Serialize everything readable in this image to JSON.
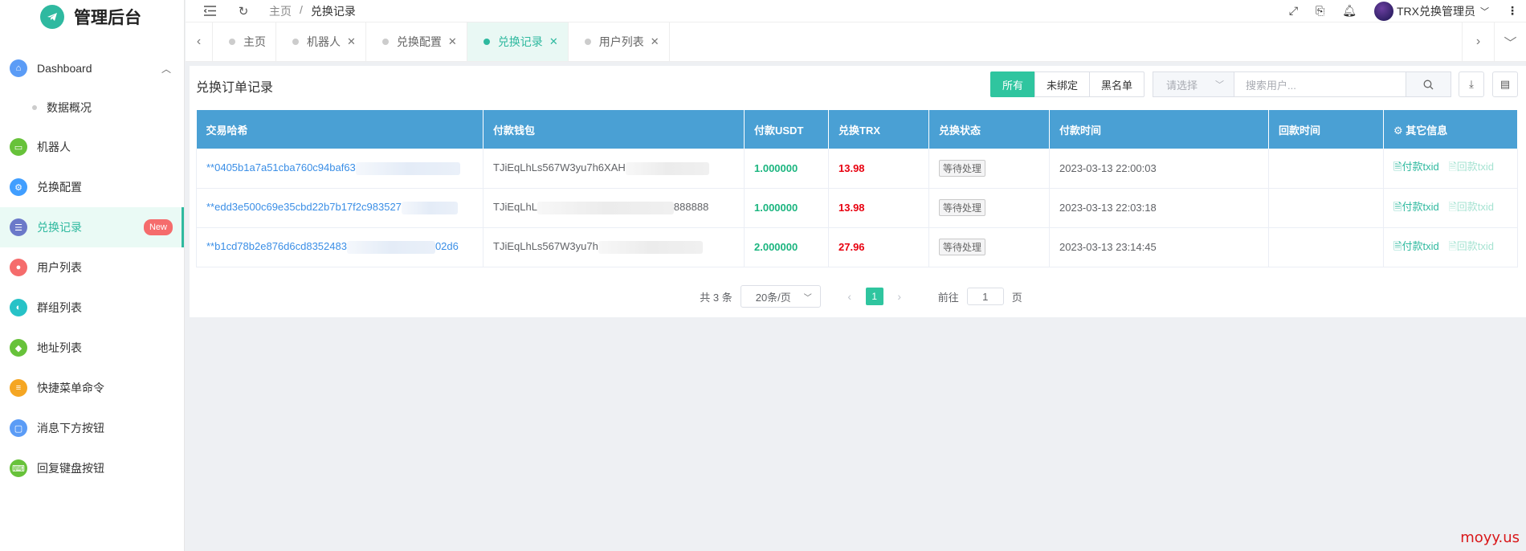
{
  "brand": {
    "title": "管理后台"
  },
  "sidebar": {
    "items": [
      {
        "label": "Dashboard",
        "icon": "home-icon",
        "color": "#5b9cf6",
        "expanded": true
      },
      {
        "label": "数据概况",
        "sub": true
      },
      {
        "label": "机器人",
        "icon": "robot-icon",
        "color": "#67c23a"
      },
      {
        "label": "兑换配置",
        "icon": "config-icon",
        "color": "#409eff"
      },
      {
        "label": "兑换记录",
        "icon": "record-icon",
        "color": "#6b79c9",
        "active": true,
        "badge": "New"
      },
      {
        "label": "用户列表",
        "icon": "user-icon",
        "color": "#f56c6c"
      },
      {
        "label": "群组列表",
        "icon": "group-icon",
        "color": "#27c2c7"
      },
      {
        "label": "地址列表",
        "icon": "box-icon",
        "color": "#67c23a"
      },
      {
        "label": "快捷菜单命令",
        "icon": "menu-cmd-icon",
        "color": "#f5a623"
      },
      {
        "label": "消息下方按钮",
        "icon": "button-icon",
        "color": "#5b9cf6"
      },
      {
        "label": "回复键盘按钮",
        "icon": "keyboard-icon",
        "color": "#67c23a"
      }
    ]
  },
  "header": {
    "breadcrumb": [
      "主页",
      "/",
      "兑换记录"
    ],
    "user_name": "TRX兑换管理员"
  },
  "tabs": [
    {
      "label": "主页",
      "closable": false
    },
    {
      "label": "机器人",
      "closable": true
    },
    {
      "label": "兑换配置",
      "closable": true
    },
    {
      "label": "兑换记录",
      "closable": true,
      "active": true
    },
    {
      "label": "用户列表",
      "closable": true
    }
  ],
  "panel": {
    "title": "兑换订单记录",
    "filters": [
      "所有",
      "未绑定",
      "黑名单"
    ],
    "select_placeholder": "请选择",
    "search_placeholder": "搜索用户..."
  },
  "table": {
    "columns": [
      "交易哈希",
      "付款钱包",
      "付款USDT",
      "兑换TRX",
      "兑换状态",
      "付款时间",
      "回款时间",
      "其它信息"
    ],
    "rows": [
      {
        "hash": "**0405b1a7a51cba760c94baf63",
        "wallet": "TJiEqLhLs567W3yu7h6XAH",
        "usdt": "1.000000",
        "trx": "13.98",
        "status": "等待处理",
        "paid_at": "2023-03-13 22:00:03",
        "refund_at": ""
      },
      {
        "hash": "**edd3e500c69e35cbd22b7b17f2c983527",
        "wallet": "TJiEqLhL",
        "wallet_tail": "888888",
        "usdt": "1.000000",
        "trx": "13.98",
        "status": "等待处理",
        "paid_at": "2023-03-13 22:03:18",
        "refund_at": ""
      },
      {
        "hash": "**b1cd78b2e876d6cd8352483",
        "hash_tail": "02d6",
        "wallet": "TJiEqLhLs567W3yu7h",
        "usdt": "2.000000",
        "trx": "27.96",
        "status": "等待处理",
        "paid_at": "2023-03-13 23:14:45",
        "refund_at": ""
      }
    ],
    "actions": [
      "付款txid",
      "回款txid"
    ]
  },
  "pager": {
    "total_text": "共 3 条",
    "page_size": "20条/页",
    "current_page": "1",
    "goto_label": "前往",
    "goto_value": "1",
    "page_unit": "页"
  },
  "watermark": "moyy.us",
  "colors": {
    "accent": "#2fb99f",
    "table_header": "#4aa0d4",
    "usdt": "#1bb57f",
    "trx": "#e8000f"
  }
}
